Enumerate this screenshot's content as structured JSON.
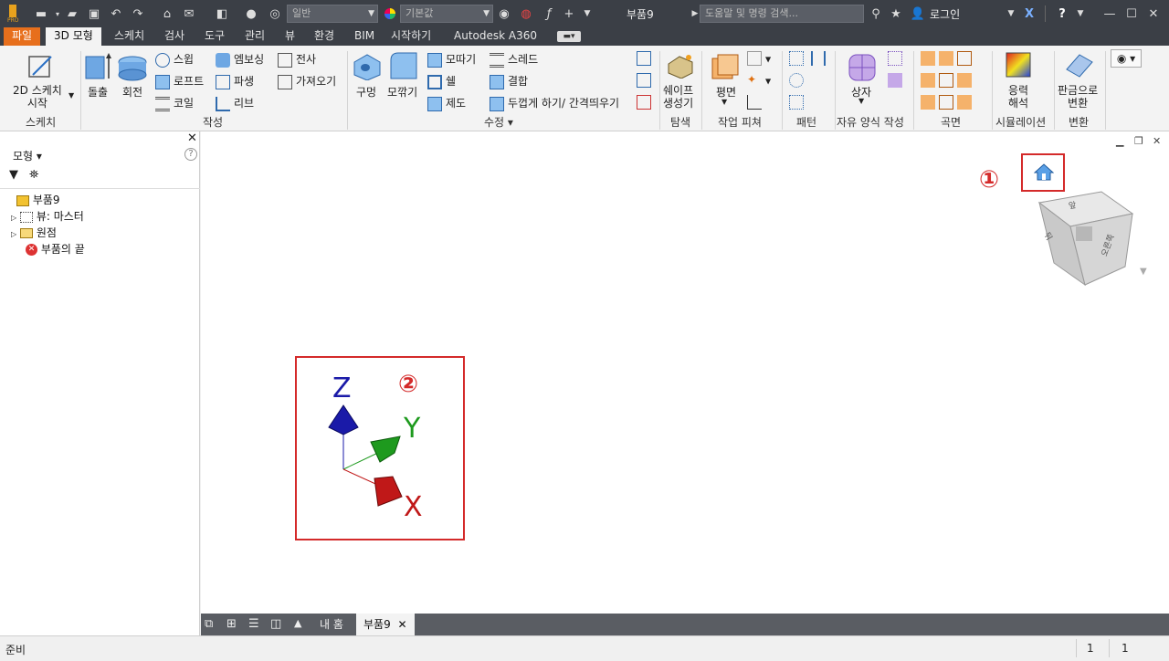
{
  "quick_access": {
    "app_icon": "inventor-pro-icon",
    "style_combo": "일반",
    "material_combo": "기본값",
    "document_title": "부품9",
    "search_placeholder": "도움말 및 명령 검색...",
    "login_label": "로그인",
    "help_label": "?"
  },
  "tabs": [
    {
      "label": "파일"
    },
    {
      "label": "3D 모형"
    },
    {
      "label": "스케치"
    },
    {
      "label": "검사"
    },
    {
      "label": "도구"
    },
    {
      "label": "관리"
    },
    {
      "label": "뷰"
    },
    {
      "label": "환경"
    },
    {
      "label": "BIM"
    },
    {
      "label": "시작하기"
    },
    {
      "label": "Autodesk A360"
    }
  ],
  "ribbon": {
    "sketch_btn": "2D 스케치\n시작",
    "sketch_panel": "스케치",
    "extrude": "돌출",
    "revolve": "회전",
    "sweep": "스윕",
    "loft": "로프트",
    "coil": "코일",
    "emboss": "엠보싱",
    "derive": "파생",
    "rib": "리브",
    "decal": "전사",
    "import": "가져오기",
    "create_panel": "작성",
    "hole": "구멍",
    "fillet": "모깎기",
    "chamfer": "모따기",
    "shell": "쉘",
    "draft": "제도",
    "thread": "스레드",
    "combine": "결합",
    "thicken": "두껍게 하기/ 간격띄우기",
    "modify_panel": "수정",
    "shape_gen": "쉐이프\n생성기",
    "explore_panel": "탐색",
    "plane": "평면",
    "workfeat_panel": "작업 피쳐",
    "pattern_panel": "패턴",
    "box": "상자",
    "freeform_panel": "자유 양식 작성",
    "surface_panel": "곡면",
    "stress": "응력\n해석",
    "sim_panel": "시뮬레이션",
    "sheetmetal": "판금으로\n변환",
    "convert_panel": "변환"
  },
  "browser": {
    "title": "모형",
    "items": [
      {
        "label": "부품9"
      },
      {
        "label": "뷰: 마스터"
      },
      {
        "label": "원점"
      },
      {
        "label": "부품의 끝"
      }
    ]
  },
  "viewport": {
    "marker1": "①",
    "marker2": "②",
    "axis_x": "X",
    "axis_y": "Y",
    "axis_z": "Z",
    "viewcube_top": "앞",
    "viewcube_front": "오른쪽",
    "viewcube_left": "뒤"
  },
  "doc_tabs": [
    {
      "label": "내 홈"
    },
    {
      "label": "부품9"
    }
  ],
  "status": {
    "text": "준비",
    "count1": "1",
    "count2": "1"
  },
  "colors": {
    "accent_orange": "#e76f1c",
    "title_bg": "#3b3f46",
    "highlight_red": "#d42a2a",
    "axis_x": "#c01818",
    "axis_y": "#1e9a1e",
    "axis_z": "#1a1aa8"
  }
}
